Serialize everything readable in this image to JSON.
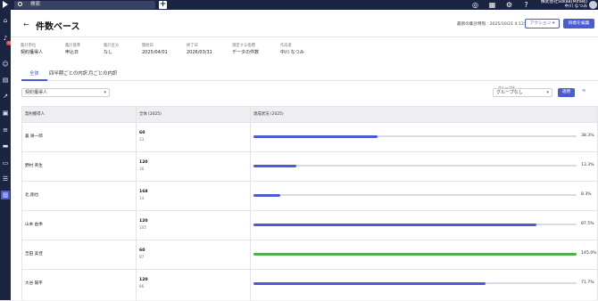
{
  "topbar": {
    "search_placeholder": "検索",
    "company": "株式会社Sokaa(Mirale)",
    "user": "中川 なつみ"
  },
  "sidebar": {
    "badge_count": "14",
    "items": [
      "home-icon",
      "bell-icon",
      "user-circle-icon",
      "document-icon",
      "trend-icon",
      "person-card-icon",
      "list-edit-icon",
      "folder-icon",
      "card-icon",
      "checklist-icon",
      "bar-chart-icon"
    ]
  },
  "header": {
    "back_label": "←",
    "title": "件数ベース",
    "updated": "最新の集計時刻 : 2025/10/21 4:12:42",
    "action_label": "アクション ▾",
    "edit_label": "目標を編集"
  },
  "meta": [
    {
      "label": "集計単位",
      "value": "契約獲得人"
    },
    {
      "label": "集計基準",
      "value": "申込日"
    },
    {
      "label": "集計区分",
      "value": "なし"
    },
    {
      "label": "開始日",
      "value": "2025/04/01"
    },
    {
      "label": "終了日",
      "value": "2026/03/31"
    },
    {
      "label": "測定する指標",
      "value": "データの件数"
    },
    {
      "label": "作成者",
      "value": "中川 なつみ"
    }
  ],
  "tabs": [
    "全体",
    "四半期ごとの内訳",
    "月ごとの内訳"
  ],
  "filter": {
    "person_select": "契約獲得人",
    "group_label": "グループ化",
    "group_select": "グループなし",
    "apply_label": "適用",
    "reset_label": "⟲"
  },
  "table": {
    "headers": [
      "契約獲得人",
      "全体 (2025)",
      "達成状況 (2025)"
    ],
    "rows": [
      {
        "name": "兼 咲一郎",
        "target": "60",
        "actual": "23",
        "pct": "38.3%",
        "progress": 0.383,
        "color": "#4a5bd4"
      },
      {
        "name": "野村 英生",
        "target": "120",
        "actual": "16",
        "pct": "13.3%",
        "progress": 0.133,
        "color": "#4a5bd4"
      },
      {
        "name": "北 翔也",
        "target": "168",
        "actual": "14",
        "pct": "8.3%",
        "progress": 0.083,
        "color": "#4a5bd4"
      },
      {
        "name": "山本 由季",
        "target": "120",
        "actual": "105",
        "pct": "87.5%",
        "progress": 0.875,
        "color": "#4a5bd4"
      },
      {
        "name": "吉田 美佳",
        "target": "60",
        "actual": "87",
        "pct": "145.0%",
        "progress": 1.0,
        "color": "#4caf50"
      },
      {
        "name": "大谷 陽平",
        "target": "120",
        "actual": "86",
        "pct": "71.7%",
        "progress": 0.717,
        "color": "#4a5bd4"
      }
    ]
  }
}
